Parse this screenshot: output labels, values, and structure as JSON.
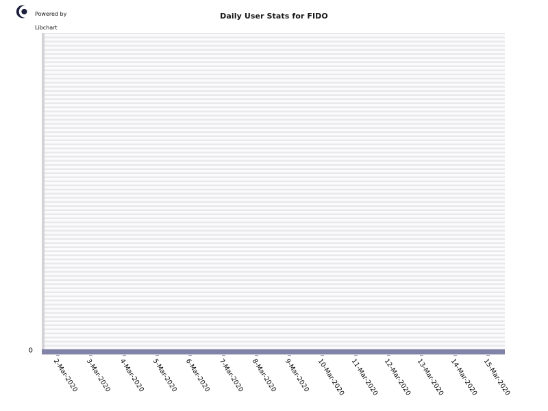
{
  "branding": {
    "line1": "Powered by",
    "line2": "Libchart",
    "logo_icon": "libchart-crescent-logo",
    "logo_color": "#1b1f3b"
  },
  "chart_data": {
    "type": "bar",
    "title": "Daily User Stats for FIDO",
    "xlabel": "",
    "ylabel": "",
    "categories": [
      "2-Mar-2020",
      "3-Mar-2020",
      "4-Mar-2020",
      "5-Mar-2020",
      "6-Mar-2020",
      "7-Mar-2020",
      "8-Mar-2020",
      "9-Mar-2020",
      "10-Mar-2020",
      "11-Mar-2020",
      "12-Mar-2020",
      "13-Mar-2020",
      "14-Mar-2020",
      "15-Mar-2020"
    ],
    "values": [
      0,
      0,
      0,
      0,
      0,
      0,
      0,
      0,
      0,
      0,
      0,
      0,
      0,
      0
    ],
    "ytick_labels": [
      "0"
    ],
    "ytick_values": [
      0
    ],
    "ylim": [
      0,
      0
    ],
    "grid": true,
    "legend": "none",
    "series_color": "#8183a8",
    "gridline_color": "#e9e9ec",
    "plot_background": "#fbfbfc",
    "axis_color": "#d3d3d7"
  }
}
